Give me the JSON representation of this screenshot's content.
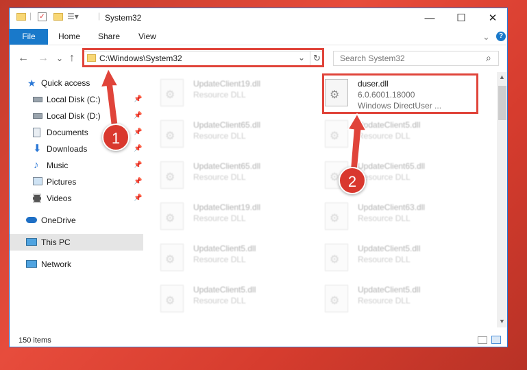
{
  "window": {
    "title": "System32",
    "controls": {
      "minimize": "—",
      "maximize": "☐",
      "close": "✕"
    }
  },
  "ribbon": {
    "tabs": [
      "File",
      "Home",
      "Share",
      "View"
    ],
    "help": "?",
    "expand": "⌄"
  },
  "nav": {
    "back": "←",
    "forward": "→",
    "recent": "⌄",
    "up": "↑",
    "address": "C:\\Windows\\System32",
    "refresh": "↻",
    "address_dropdown": "⌄",
    "search_placeholder": "Search System32",
    "search_icon": "⌕"
  },
  "sidebar": {
    "items": [
      {
        "label": "Quick access",
        "icon": "star-icon"
      },
      {
        "label": "Local Disk (C:)",
        "icon": "drive-icon"
      },
      {
        "label": "Local Disk (D:)",
        "icon": "drive-icon"
      },
      {
        "label": "Documents",
        "icon": "documents-icon"
      },
      {
        "label": "Downloads",
        "icon": "download-icon"
      },
      {
        "label": "Music",
        "icon": "music-icon"
      },
      {
        "label": "Pictures",
        "icon": "pictures-icon"
      },
      {
        "label": "Videos",
        "icon": "videos-icon"
      },
      {
        "label": "OneDrive",
        "icon": "cloud-icon"
      },
      {
        "label": "This PC",
        "icon": "computer-icon"
      },
      {
        "label": "Network",
        "icon": "network-icon"
      }
    ]
  },
  "files": [
    {
      "name": "UpdateClient19.dll",
      "type": "Resource DLL"
    },
    {
      "name": "duser.dll",
      "version": "6.0.6001.18000",
      "description": "Windows DirectUser ..."
    },
    {
      "name": "UpdateClient65.dll",
      "type": "Resource DLL"
    },
    {
      "name": "UpdateClient5.dll",
      "type": "Resource DLL"
    },
    {
      "name": "UpdateClient65.dll",
      "type": "Resource DLL"
    },
    {
      "name": "UpdateClient65.dll",
      "type": "Resource DLL"
    },
    {
      "name": "UpdateClient19.dll",
      "type": "Resource DLL"
    },
    {
      "name": "UpdateClient63.dll",
      "type": "Resource DLL"
    },
    {
      "name": "UpdateClient5.dll",
      "type": "Resource DLL"
    },
    {
      "name": "UpdateClient5.dll",
      "type": "Resource DLL"
    },
    {
      "name": "UpdateClient5.dll",
      "type": "Resource DLL"
    },
    {
      "name": "UpdateClient5.dll",
      "type": "Resource DLL"
    }
  ],
  "status": {
    "item_count": "150 items"
  },
  "annotations": {
    "step1": "1",
    "step2": "2"
  },
  "colors": {
    "accent": "#1979ca",
    "callout": "#e0443a",
    "background": "#d63c2e"
  }
}
